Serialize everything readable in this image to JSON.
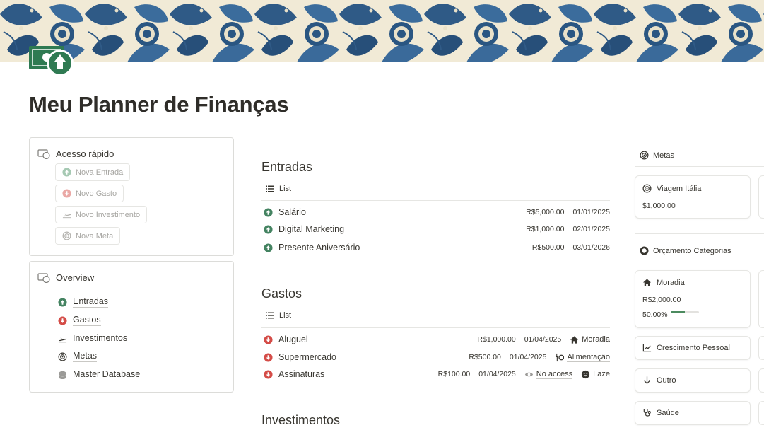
{
  "page": {
    "title": "Meu Planner de Finanças"
  },
  "colors": {
    "up": "#448361",
    "down": "#d44c47",
    "accent": "#2f7a52",
    "progress": "#4c8b5f"
  },
  "quick_access": {
    "title": "Acesso rápido",
    "buttons": [
      {
        "label": "Nova Entrada",
        "icon": "arrow-up-circle-icon"
      },
      {
        "label": "Novo Gasto",
        "icon": "arrow-down-circle-icon"
      },
      {
        "label": "Novo Investimento",
        "icon": "plane-icon"
      },
      {
        "label": "Nova Meta",
        "icon": "target-icon"
      }
    ]
  },
  "overview": {
    "title": "Overview",
    "items": [
      {
        "label": "Entradas",
        "icon": "arrow-up-circle-icon"
      },
      {
        "label": "Gastos",
        "icon": "arrow-down-circle-icon"
      },
      {
        "label": "Investimentos",
        "icon": "plane-icon"
      },
      {
        "label": "Metas",
        "icon": "target-icon"
      },
      {
        "label": "Master Database",
        "icon": "database-icon"
      }
    ]
  },
  "entradas": {
    "title": "Entradas",
    "view": "List",
    "rows": [
      {
        "name": "Salário",
        "amount": "R$5,000.00",
        "date": "01/01/2025"
      },
      {
        "name": "Digital Marketing",
        "amount": "R$1,000.00",
        "date": "02/01/2025"
      },
      {
        "name": "Presente Aniversário",
        "amount": "R$500.00",
        "date": "03/01/2026"
      }
    ]
  },
  "gastos": {
    "title": "Gastos",
    "view": "List",
    "rows": [
      {
        "name": "Aluguel",
        "amount": "R$1,000.00",
        "date": "01/04/2025",
        "category": "Moradia"
      },
      {
        "name": "Supermercado",
        "amount": "R$500.00",
        "date": "01/04/2025",
        "category": "Alimentação"
      },
      {
        "name": "Assinaturas",
        "amount": "R$100.00",
        "date": "01/04/2025",
        "access": "No access",
        "category": "Laze"
      }
    ]
  },
  "investimentos": {
    "title": "Investimentos"
  },
  "metas": {
    "title": "Metas",
    "cards": [
      {
        "title": "Viagem Itália",
        "value": "$1,000.00"
      }
    ]
  },
  "orcamento": {
    "title": "Orçamento Categorias",
    "cards": [
      {
        "title": "Moradia",
        "value": "R$2,000.00",
        "progress_label": "50.00%",
        "progress": 0.5
      },
      {
        "title": "Crescimento Pessoal"
      },
      {
        "title": "Outro"
      },
      {
        "title": "Saúde"
      }
    ]
  }
}
